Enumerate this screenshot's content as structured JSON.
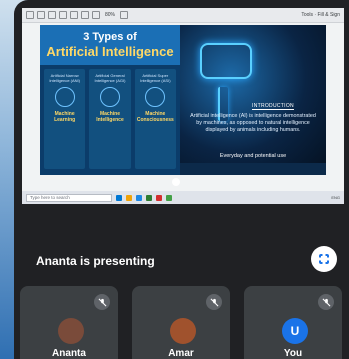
{
  "presentation": {
    "toolbar": {
      "zoom": "80%",
      "tools": "Tools · Fill & Sign"
    },
    "slide": {
      "title_line1": "3 Types of",
      "title_line2": "Artificial Intelligence",
      "types": [
        {
          "top": "Artificial Narrow Intelligence (ANI)",
          "name": "Machine Learning"
        },
        {
          "top": "Artificial General Intelligence (AGI)",
          "name": "Machine Intelligence"
        },
        {
          "top": "Artificial Super Intelligence (ASI)",
          "name": "Machine Consciousness"
        }
      ],
      "intro_label": "INTRODUCTION",
      "intro_text": "Artificial intelligence (AI) is intelligence demonstrated by machines, as opposed to natural intelligence displayed by animals including humans.",
      "subheading": "Everyday and potential use"
    },
    "taskbar": {
      "search_placeholder": "Type here to search",
      "tray": "ENG"
    }
  },
  "presenter": {
    "label": "Ananta is presenting"
  },
  "participants": [
    {
      "avatar_type": "photo",
      "avatar_color": "#7a4b3a",
      "name": "Ananta"
    },
    {
      "avatar_type": "photo",
      "avatar_color": "#a0522d",
      "name": "Amar"
    },
    {
      "avatar_type": "initial",
      "initial": "U",
      "avatar_color": "#1a73e8",
      "name": "You"
    }
  ],
  "colors": {
    "background": "#202124",
    "tile": "#3c4043",
    "accent": "#1a73e8"
  },
  "icons": {
    "mute": "mic-off-icon",
    "fullscreen": "fullscreen-icon"
  }
}
